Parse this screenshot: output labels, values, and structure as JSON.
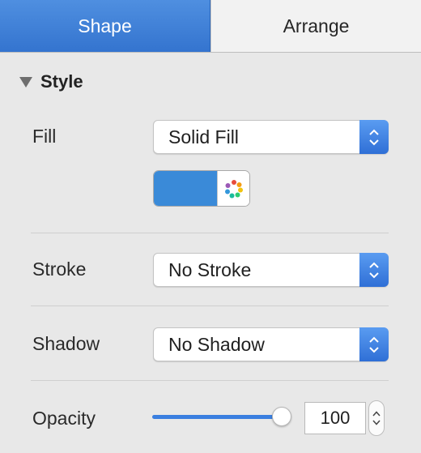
{
  "tabs": [
    {
      "label": "Shape",
      "active": true
    },
    {
      "label": "Arrange",
      "active": false
    }
  ],
  "section": {
    "title": "Style",
    "expanded": true
  },
  "fill": {
    "label": "Fill",
    "value": "Solid Fill",
    "color": "#3a8ad8",
    "picker_icon": "color-wheel-icon"
  },
  "stroke": {
    "label": "Stroke",
    "value": "No Stroke"
  },
  "shadow": {
    "label": "Shadow",
    "value": "No Shadow"
  },
  "opacity": {
    "label": "Opacity",
    "value": "100",
    "fraction": 1.0
  },
  "colors": {
    "accent": "#3474cf",
    "background": "#e8e8e8"
  }
}
